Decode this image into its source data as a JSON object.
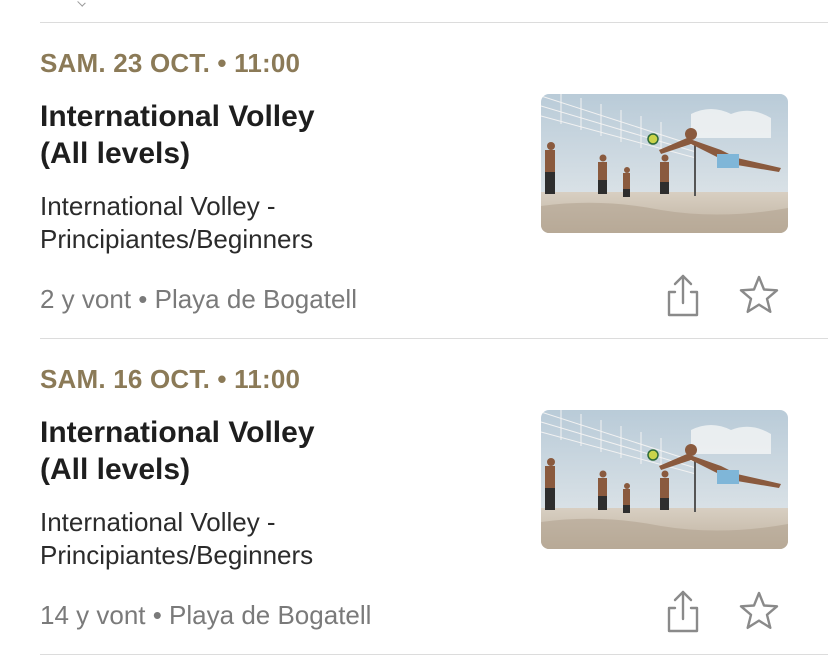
{
  "events": [
    {
      "date": "SAM. 23 OCT. • 11:00",
      "title_line1": "International Volley",
      "title_line2": "(All levels)",
      "desc_line1": "International Volley -",
      "desc_line2": "Principiantes/Beginners",
      "meta": "2 y vont • Playa de Bogatell",
      "icons": [
        "beach-volleyball-photo",
        "share-icon",
        "star-icon"
      ]
    },
    {
      "date": "SAM. 16 OCT. • 11:00",
      "title_line1": "International Volley",
      "title_line2": "(All levels)",
      "desc_line1": "International Volley -",
      "desc_line2": "Principiantes/Beginners",
      "meta": "14 y vont • Playa de Bogatell",
      "icons": [
        "beach-volleyball-photo",
        "share-icon",
        "star-icon"
      ]
    }
  ],
  "colors": {
    "date": "#8b7a57",
    "title": "#1e1e1e",
    "meta": "#7a7a7a",
    "icon": "#8a8a8a",
    "divider": "#dcdcdc"
  }
}
